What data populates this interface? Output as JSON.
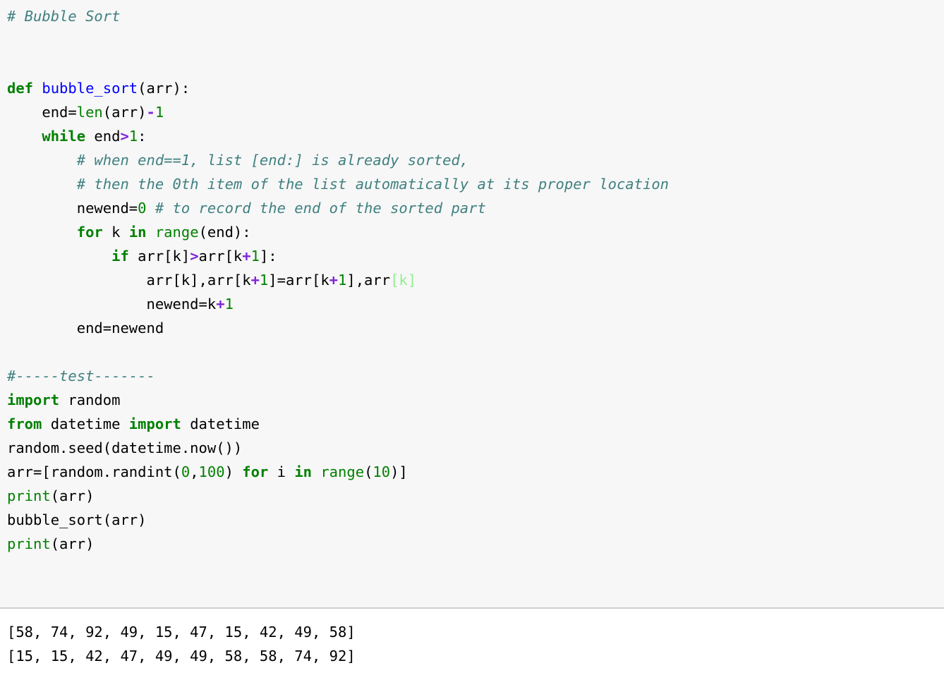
{
  "cell": {
    "kind": "jupyter-code-cell",
    "language": "python",
    "background": "#f7f7f7",
    "separator_color": "#cfcfcf"
  },
  "theme": {
    "comment": "#408080",
    "keyword": "#008000",
    "function_name": "#0000ff",
    "builtin": "#008000",
    "number": "#008000",
    "operator_word": "#7f26d9",
    "error_bracket": "#90ee90",
    "text": "#000000",
    "output_text": "#000000"
  },
  "code": {
    "lines": [
      {
        "id": "line-1",
        "tokens": [
          {
            "t": "com",
            "v": "# Bubble Sort"
          }
        ]
      },
      {
        "id": "line-2",
        "tokens": []
      },
      {
        "id": "line-3",
        "tokens": []
      },
      {
        "id": "line-4",
        "tokens": [
          {
            "t": "kw",
            "v": "def"
          },
          {
            "t": "txt",
            "v": " "
          },
          {
            "t": "fn",
            "v": "bubble_sort"
          },
          {
            "t": "txt",
            "v": "(arr):"
          }
        ]
      },
      {
        "id": "line-5",
        "tokens": [
          {
            "t": "txt",
            "v": "    end="
          },
          {
            "t": "bin",
            "v": "len"
          },
          {
            "t": "txt",
            "v": "(arr)"
          },
          {
            "t": "opw",
            "v": "-"
          },
          {
            "t": "num",
            "v": "1"
          }
        ]
      },
      {
        "id": "line-6",
        "tokens": [
          {
            "t": "txt",
            "v": "    "
          },
          {
            "t": "kw",
            "v": "while"
          },
          {
            "t": "txt",
            "v": " end"
          },
          {
            "t": "opw",
            "v": ">"
          },
          {
            "t": "num",
            "v": "1"
          },
          {
            "t": "txt",
            "v": ":"
          }
        ]
      },
      {
        "id": "line-7",
        "tokens": [
          {
            "t": "txt",
            "v": "        "
          },
          {
            "t": "com",
            "v": "# when end==1, list [end:] is already sorted,"
          }
        ]
      },
      {
        "id": "line-8",
        "tokens": [
          {
            "t": "txt",
            "v": "        "
          },
          {
            "t": "com",
            "v": "# then the 0th item of the list automatically at its proper location"
          }
        ]
      },
      {
        "id": "line-9",
        "tokens": [
          {
            "t": "txt",
            "v": "        newend="
          },
          {
            "t": "num",
            "v": "0"
          },
          {
            "t": "txt",
            "v": " "
          },
          {
            "t": "com",
            "v": "# to record the end of the sorted part"
          }
        ]
      },
      {
        "id": "line-10",
        "tokens": [
          {
            "t": "txt",
            "v": "        "
          },
          {
            "t": "kw",
            "v": "for"
          },
          {
            "t": "txt",
            "v": " k "
          },
          {
            "t": "kw",
            "v": "in"
          },
          {
            "t": "txt",
            "v": " "
          },
          {
            "t": "bin",
            "v": "range"
          },
          {
            "t": "txt",
            "v": "(end):"
          }
        ]
      },
      {
        "id": "line-11",
        "tokens": [
          {
            "t": "txt",
            "v": "            "
          },
          {
            "t": "kw",
            "v": "if"
          },
          {
            "t": "txt",
            "v": " arr[k]"
          },
          {
            "t": "opw",
            "v": ">"
          },
          {
            "t": "txt",
            "v": "arr[k"
          },
          {
            "t": "opw",
            "v": "+"
          },
          {
            "t": "num",
            "v": "1"
          },
          {
            "t": "txt",
            "v": "]:"
          }
        ]
      },
      {
        "id": "line-12",
        "tokens": [
          {
            "t": "txt",
            "v": "                arr[k],arr[k"
          },
          {
            "t": "opw",
            "v": "+"
          },
          {
            "t": "num",
            "v": "1"
          },
          {
            "t": "txt",
            "v": "]=arr[k"
          },
          {
            "t": "opw",
            "v": "+"
          },
          {
            "t": "num",
            "v": "1"
          },
          {
            "t": "txt",
            "v": "],arr"
          },
          {
            "t": "err",
            "v": "[k]"
          }
        ]
      },
      {
        "id": "line-13",
        "tokens": [
          {
            "t": "txt",
            "v": "                newend=k"
          },
          {
            "t": "opw",
            "v": "+"
          },
          {
            "t": "num",
            "v": "1"
          }
        ]
      },
      {
        "id": "line-14",
        "tokens": [
          {
            "t": "txt",
            "v": "        end=newend"
          }
        ]
      },
      {
        "id": "line-15",
        "tokens": []
      },
      {
        "id": "line-16",
        "tokens": [
          {
            "t": "com",
            "v": "#-----test-------"
          }
        ]
      },
      {
        "id": "line-17",
        "tokens": [
          {
            "t": "kw",
            "v": "import"
          },
          {
            "t": "txt",
            "v": " random"
          }
        ]
      },
      {
        "id": "line-18",
        "tokens": [
          {
            "t": "kw",
            "v": "from"
          },
          {
            "t": "txt",
            "v": " datetime "
          },
          {
            "t": "kw",
            "v": "import"
          },
          {
            "t": "txt",
            "v": " datetime"
          }
        ]
      },
      {
        "id": "line-19",
        "tokens": [
          {
            "t": "txt",
            "v": "random.seed(datetime.now())"
          }
        ]
      },
      {
        "id": "line-20",
        "tokens": [
          {
            "t": "txt",
            "v": "arr=[random.randint("
          },
          {
            "t": "num",
            "v": "0"
          },
          {
            "t": "txt",
            "v": ","
          },
          {
            "t": "num",
            "v": "100"
          },
          {
            "t": "txt",
            "v": ") "
          },
          {
            "t": "kw",
            "v": "for"
          },
          {
            "t": "txt",
            "v": " i "
          },
          {
            "t": "kw",
            "v": "in"
          },
          {
            "t": "txt",
            "v": " "
          },
          {
            "t": "bin",
            "v": "range"
          },
          {
            "t": "txt",
            "v": "("
          },
          {
            "t": "num",
            "v": "10"
          },
          {
            "t": "txt",
            "v": ")]"
          }
        ]
      },
      {
        "id": "line-21",
        "tokens": [
          {
            "t": "bin",
            "v": "print"
          },
          {
            "t": "txt",
            "v": "(arr)"
          }
        ]
      },
      {
        "id": "line-22",
        "tokens": [
          {
            "t": "txt",
            "v": "bubble_sort(arr)"
          }
        ]
      },
      {
        "id": "line-23",
        "tokens": [
          {
            "t": "bin",
            "v": "print"
          },
          {
            "t": "txt",
            "v": "(arr)"
          }
        ]
      }
    ]
  },
  "output": {
    "lines": [
      "[58, 74, 92, 49, 15, 47, 15, 42, 49, 58]",
      "[15, 15, 42, 47, 49, 49, 58, 58, 74, 92]"
    ],
    "unsorted_array": [
      58,
      74,
      92,
      49,
      15,
      47,
      15,
      42,
      49,
      58
    ],
    "sorted_array": [
      15,
      15,
      42,
      47,
      49,
      49,
      58,
      58,
      74,
      92
    ]
  }
}
